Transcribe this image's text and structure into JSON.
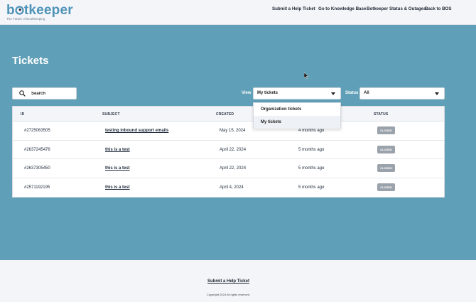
{
  "header": {
    "logo_text_pre": "b",
    "logo_text_post": "tkeeper",
    "logo_tagline": "The Future of Bookkeeping",
    "nav": [
      "Submit a Help Ticket",
      "Go to Knowledge Base",
      "Botkeeper Status & Outages",
      "Back to BOS"
    ]
  },
  "page": {
    "title": "Tickets"
  },
  "filters": {
    "search_placeholder": "Search",
    "view_label": "View",
    "view_value": "My tickets",
    "status_label": "Status",
    "status_value": "All"
  },
  "dropdown": {
    "options": [
      "Organization tickets",
      "My tickets"
    ],
    "highlighted": "My tickets"
  },
  "table": {
    "headers": [
      "ID",
      "SUBJECT",
      "CREATED",
      "STATUS"
    ],
    "rows": [
      {
        "id": "#2725063505",
        "subject": "testing inbound support emails",
        "created": "May 15, 2024",
        "updated": "4 months ago",
        "status": "CLOSED"
      },
      {
        "id": "#2637245476",
        "subject": "this is a test",
        "created": "April 22, 2024",
        "updated": "5 months ago",
        "status": "CLOSED"
      },
      {
        "id": "#2637305450",
        "subject": "this is a test",
        "created": "April 22, 2024",
        "updated": "5 months ago",
        "status": "CLOSED"
      },
      {
        "id": "#2571192195",
        "subject": "this is a test",
        "created": "April 4, 2024",
        "updated": "5 months ago",
        "status": "CLOSED"
      }
    ]
  },
  "footer": {
    "link": "Submit a Help Ticket",
    "copyright": "Copyright 2024 All rights reserved."
  },
  "colors": {
    "brand": "#4d93b8",
    "hero_bg": "#5f9fb7",
    "badge_closed": "#9aa2ab"
  }
}
